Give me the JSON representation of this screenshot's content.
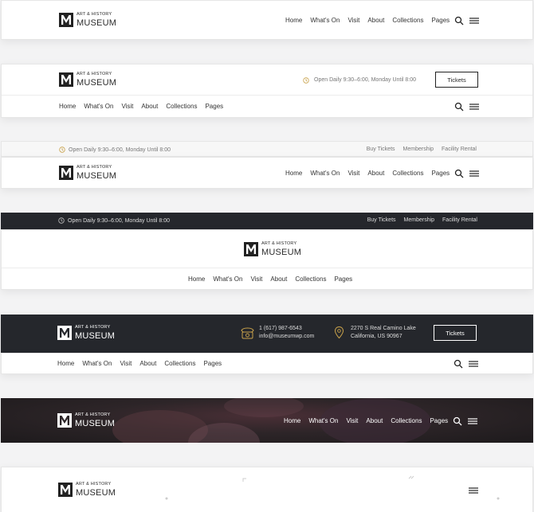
{
  "brand": {
    "small": "ART & HISTORY",
    "big": "MUSEUM"
  },
  "nav": [
    "Home",
    "What's On",
    "Visit",
    "About",
    "Collections",
    "Pages"
  ],
  "hours": "Open Daily 9:30–6:00, Monday Until 8:00",
  "top_links": [
    "Buy Tickets",
    "Membership",
    "Facility Rental"
  ],
  "tickets_label": "Tickets",
  "contact": {
    "phone": "1 (617) 987-6543",
    "email": "info@museumwp.com",
    "addr1": "2270 S Real Camino Lake",
    "addr2": "California, US 90967"
  },
  "colors": {
    "accent": "#c9a24b",
    "dark": "#25272c",
    "hero": "#2d2528"
  },
  "icons": [
    "search-icon",
    "menu-icon",
    "clock-icon",
    "phone-icon",
    "location-icon",
    "museum-logo-icon"
  ]
}
